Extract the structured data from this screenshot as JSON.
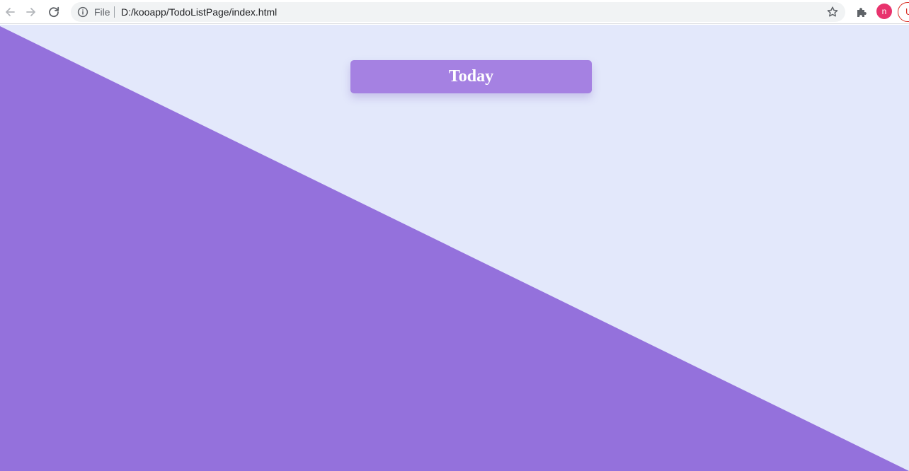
{
  "browser": {
    "scheme_label": "File",
    "url": "D:/kooapp/TodoListPage/index.html",
    "avatar_letter": "n",
    "update_label": "U",
    "icons": {
      "back": "arrow-left-icon",
      "forward": "arrow-right-icon",
      "reload": "reload-icon",
      "info": "info-icon",
      "bookmark": "star-icon",
      "extensions": "puzzle-icon"
    }
  },
  "page": {
    "header_title": "Today"
  },
  "colors": {
    "page_background": "#e3e8fb",
    "triangle": "#9471dc",
    "header_background": "#a581e2",
    "header_text": "#ffffff",
    "avatar": "#e8336d"
  }
}
